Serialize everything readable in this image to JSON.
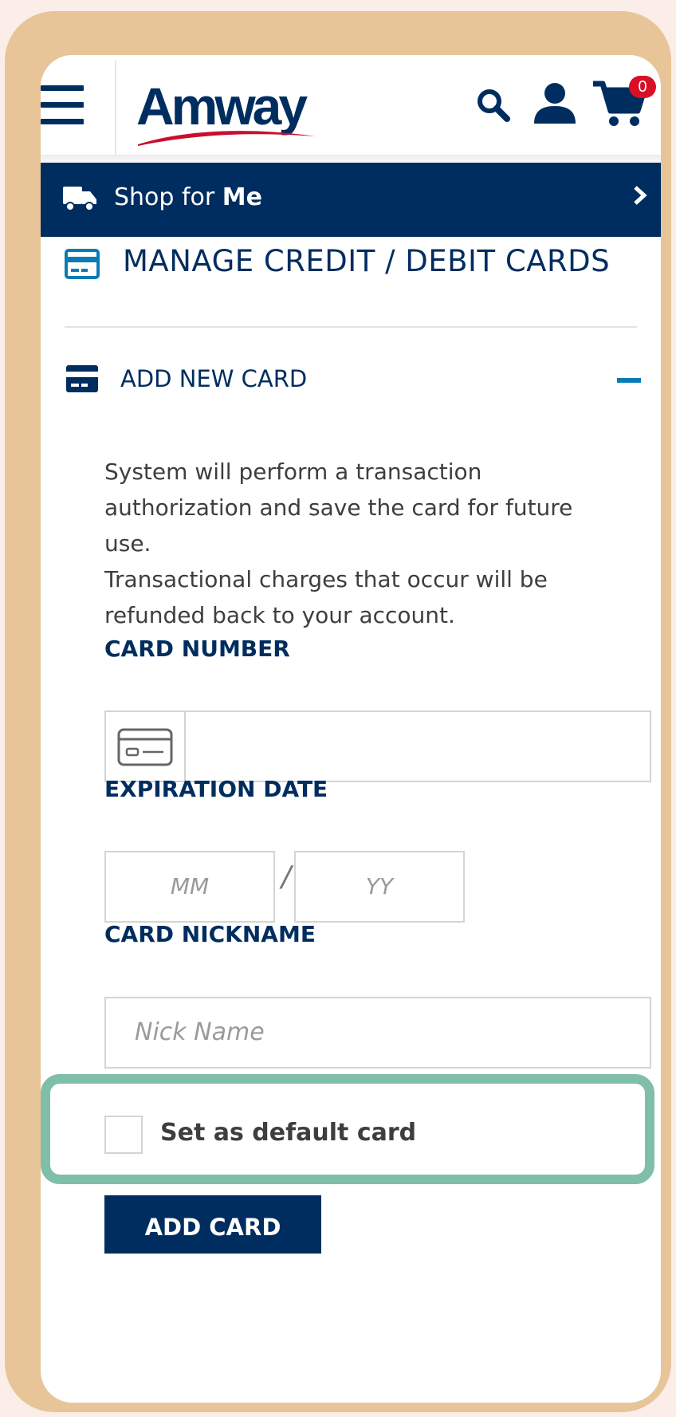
{
  "header": {
    "logo_text": "Amway",
    "cart_count": "0"
  },
  "shop_bar": {
    "prefix": "Shop for ",
    "emphasis": "Me"
  },
  "page": {
    "title": "MANAGE CREDIT / DEBIT CARDS"
  },
  "section": {
    "title": "ADD NEW CARD",
    "info_line1": "System will perform a transaction authorization and save the card for future use.",
    "info_line2": "Transactional charges that occur will be refunded back to your account."
  },
  "form": {
    "card_number_label": "CARD NUMBER",
    "card_number_value": "",
    "expiration_label": "EXPIRATION DATE",
    "month_placeholder": "MM",
    "date_separator": "/",
    "year_placeholder": "YY",
    "nickname_label": "CARD NICKNAME",
    "nickname_placeholder": "Nick Name",
    "default_label": "Set as default card",
    "default_checked": false,
    "submit_label": "ADD CARD"
  },
  "colors": {
    "brand_navy": "#002d5f",
    "accent_blue": "#0b7bb5",
    "badge_red": "#d90f25",
    "frame_tan": "#e8c598",
    "highlight_green": "#7fbfa9"
  },
  "icons": {
    "menu": "hamburger-icon",
    "search": "search-icon",
    "account": "user-icon",
    "cart": "cart-icon",
    "delivery": "truck-icon",
    "card": "credit-card-icon",
    "collapse": "minus-icon"
  }
}
